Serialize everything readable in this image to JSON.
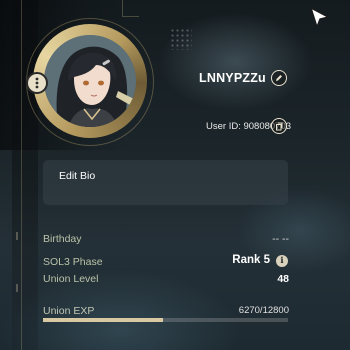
{
  "profile": {
    "username": "LNNYPZZu",
    "user_id": "User ID: 908080703"
  },
  "bio": {
    "label": "Edit Bio"
  },
  "stats": {
    "birthday": {
      "label": "Birthday",
      "value": "-- --"
    },
    "phase": {
      "label": "SOL3 Phase",
      "value": "Rank 5",
      "info_glyph": "i"
    },
    "union_level": {
      "label": "Union Level",
      "value": "48"
    },
    "union_exp": {
      "label": "Union EXP",
      "value": "6270/12800",
      "progress": 0.49
    }
  },
  "icons": {
    "more": "more-vertical-icon",
    "edit_name": "pencil-icon",
    "copy_id": "copy-icon",
    "info": "info-icon",
    "cursor": "cursor-arrow-icon"
  },
  "colors": {
    "accent_gold": "#d9c9a3",
    "label_text": "#b9c2a8"
  }
}
